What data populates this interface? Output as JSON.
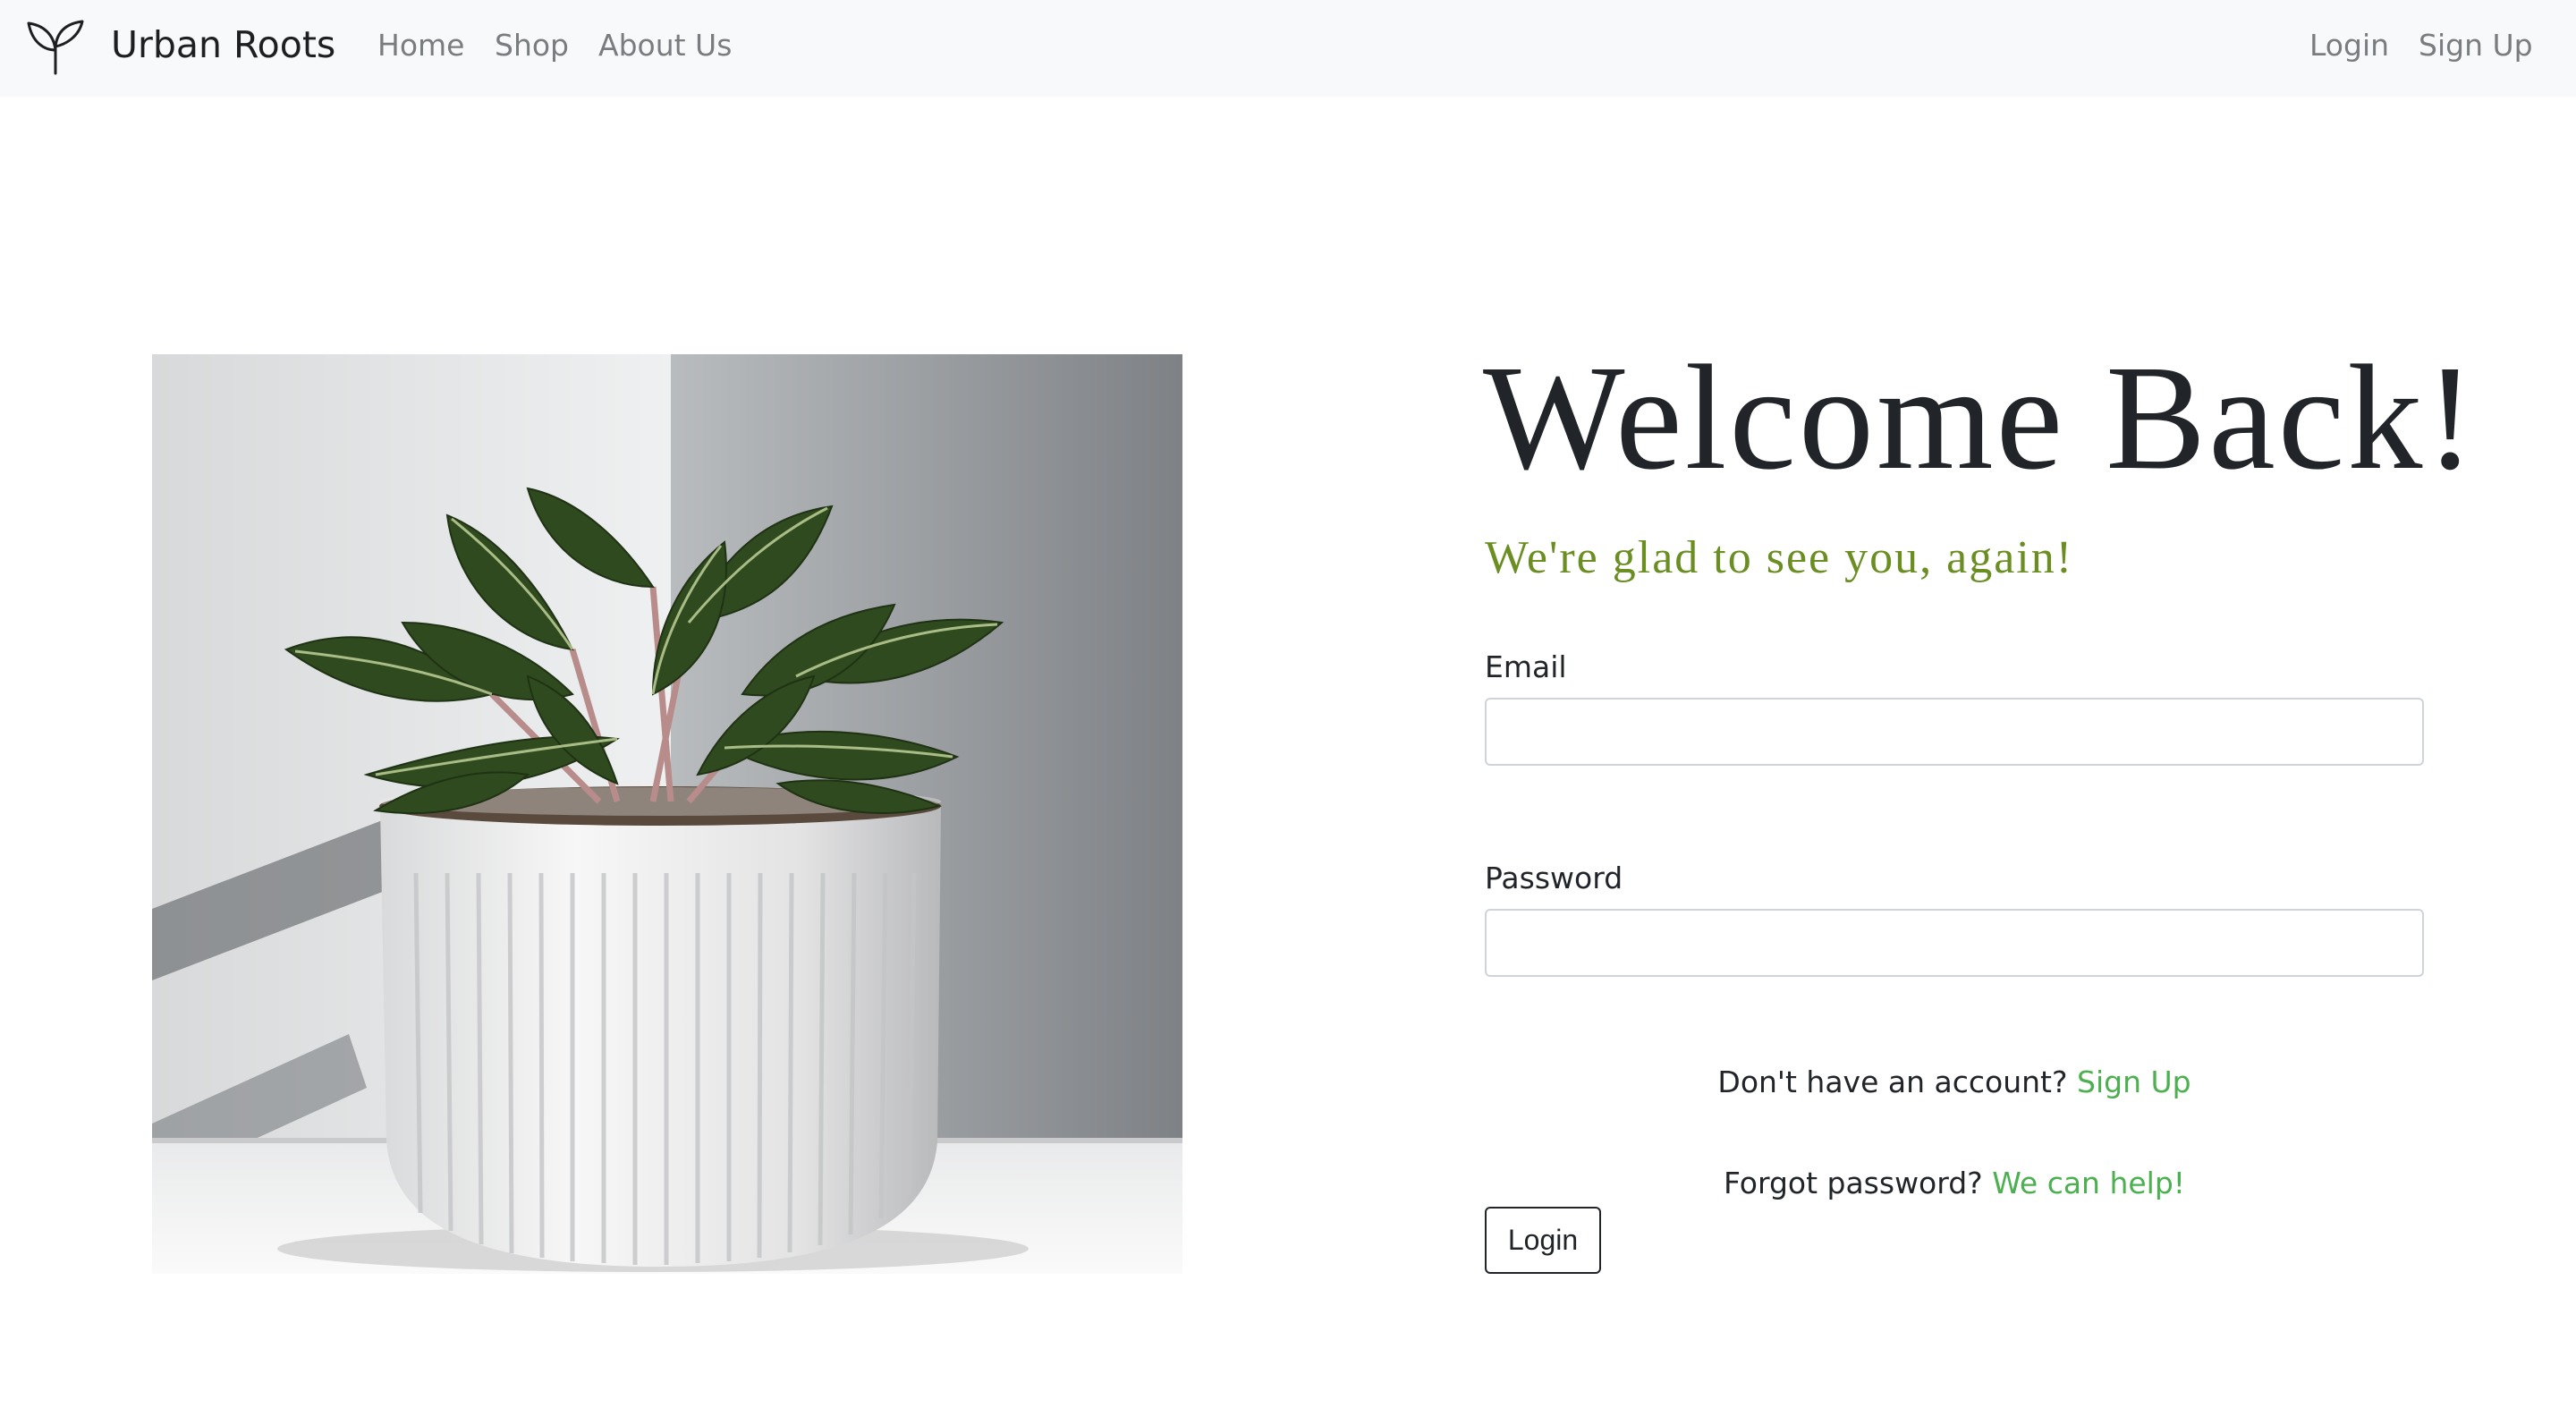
{
  "navbar": {
    "brand": "Urban Roots",
    "brand_icon": "sprout-icon",
    "links": [
      "Home",
      "Shop",
      "About Us"
    ],
    "auth_links": {
      "login": "Login",
      "signup": "Sign Up"
    }
  },
  "hero": {
    "image_subject": "potted-plant-photo"
  },
  "login_form": {
    "title": "Welcome Back!",
    "subtitle": "We're glad to see you, again!",
    "email_label": "Email",
    "email_value": "",
    "password_label": "Password",
    "password_value": "",
    "signup_prompt": "Don't have an account?",
    "signup_link": "Sign Up",
    "forgot_prompt": "Forgot password?",
    "forgot_link": "We can help!",
    "submit_label": "Login"
  },
  "colors": {
    "navbar_bg": "#f8f9fa",
    "accent_green": "#4caf50",
    "subtitle_olive": "#6b8e23",
    "text_dark": "#212529",
    "nav_muted": "#7a7d80"
  }
}
